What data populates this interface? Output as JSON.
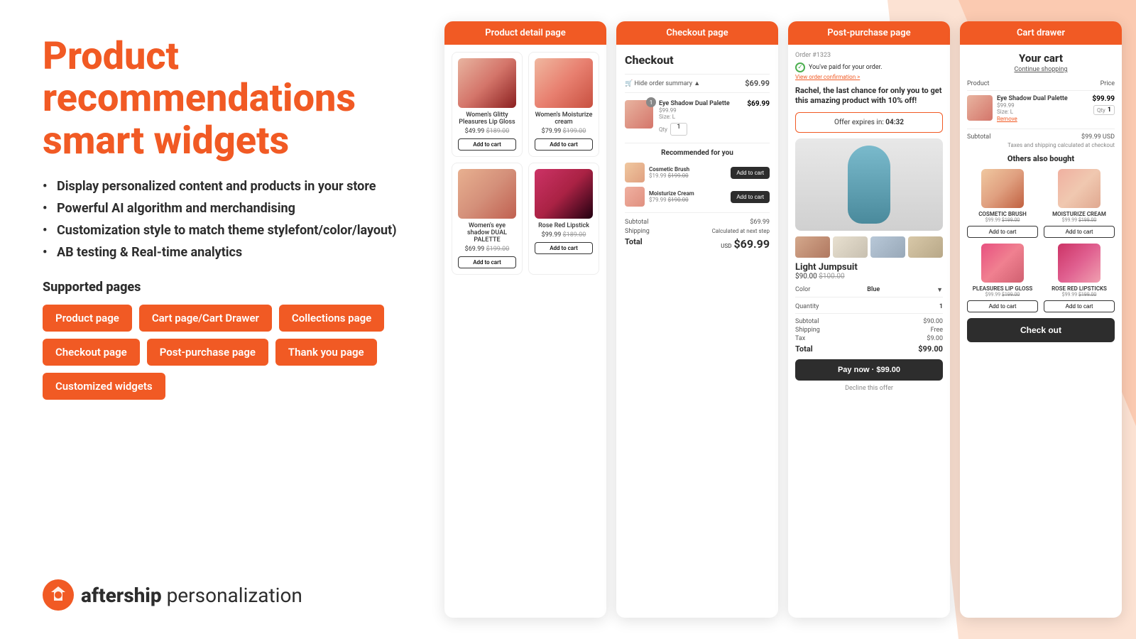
{
  "hero": {
    "title_line1": "Product",
    "title_line2": "recommendations",
    "title_highlight": "smart widgets"
  },
  "features": [
    "Display personalized content and products in your store",
    "Powerful AI algorithm and merchandising",
    "Customization style to match theme stylefont/color/layout)",
    "AB testing & Real-time analytics"
  ],
  "supported_pages": {
    "label": "Supported pages",
    "badges": [
      "Product page",
      "Cart page/Cart Drawer",
      "Collections page",
      "Checkout page",
      "Post-purchase page",
      "Thank you page",
      "Customized widgets"
    ]
  },
  "brand": {
    "name_bold": "aftership",
    "name_rest": " personalization"
  },
  "panels": {
    "product_detail": {
      "header": "Product detail page",
      "products": [
        {
          "name": "Women's Glitty Pleasures Lip Gloss",
          "price": "$49.99",
          "original": "$189.00",
          "add_btn": "Add to cart"
        },
        {
          "name": "Women's Moisturize cream",
          "price": "$79.99",
          "original": "$199.00",
          "add_btn": "Add to cart"
        },
        {
          "name": "Women's eye shadow DUAL PALETTE",
          "price": "$69.99",
          "original": "$199.00",
          "add_btn": "Add to cart"
        },
        {
          "name": "Rose Red Lipstick",
          "price": "$99.99",
          "original": "$189.00",
          "add_btn": "Add to cart"
        }
      ]
    },
    "checkout": {
      "header": "Checkout page",
      "title": "Checkout",
      "summary_toggle": "Hide order summary",
      "summary_price": "$69.99",
      "cart_item": {
        "name": "Eye Shadow Dual Palette",
        "price": "$99.99",
        "size": "Size: L",
        "qty_label": "Qty",
        "qty": "1",
        "total": "$69.99"
      },
      "recommended_title": "Recommended for you",
      "rec_items": [
        {
          "name": "Cosmetic Brush",
          "price": "$19.99",
          "original": "$199.00",
          "add_btn": "Add to cart"
        },
        {
          "name": "Moisturize Cream",
          "price": "$79.99",
          "original": "$190.00",
          "add_btn": "Add to cart"
        }
      ],
      "subtotal_label": "Subtotal",
      "subtotal_val": "$69.99",
      "shipping_label": "Shipping",
      "shipping_val": "Calculated at next step",
      "total_label": "Total",
      "total_usd": "USD",
      "total_val": "$69.99"
    },
    "post_purchase": {
      "header": "Post-purchase page",
      "order_num": "Order #1323",
      "paid_msg": "You've paid for your order.",
      "view_order": "View order confirmation >",
      "upsell_msg": "Rachel, the last chance for only you to get this amazing product with 10% off!",
      "offer_label": "Offer expires in:",
      "offer_time": "04:32",
      "product_name": "Light Jumpsuit",
      "product_price": "$90.00",
      "product_original": "$100.00",
      "color_label": "Color",
      "color_val": "Blue",
      "qty_label": "Quantity",
      "qty_val": "1",
      "subtotal_label": "Subtotal",
      "subtotal_val": "$90.00",
      "shipping_label": "Shipping",
      "shipping_val": "Free",
      "tax_label": "Tax",
      "tax_val": "$9.00",
      "total_label": "Total",
      "total_val": "$99.00",
      "pay_btn": "Pay now · $99.00",
      "decline_btn": "Decline this offer"
    },
    "cart_drawer": {
      "header": "Cart drawer",
      "your_cart": "Your cart",
      "continue_shopping": "Continue shopping",
      "col_product": "Product",
      "col_price": "Price",
      "cart_item": {
        "name": "Eye Shadow Dual Palette",
        "price": "$99.99",
        "size": "Size: L",
        "remove": "Remove",
        "qty_label": "Qty",
        "qty": "1",
        "total": "$99.99"
      },
      "subtotal_label": "Subtotal",
      "subtotal_val": "$99.99 USD",
      "tax_note": "Taxes and shipping calculated at checkout",
      "others_bought_title": "Others also bought",
      "rec_items": [
        {
          "name": "COSMETIC BRUSH",
          "price": "$99.99",
          "original": "$199.00",
          "add_btn": "Add to cart"
        },
        {
          "name": "MOISTURIZE CREAM",
          "price": "$99.99",
          "original": "$199.00",
          "add_btn": "Add to cart"
        },
        {
          "name": "PLEASURES LIP GLOSS",
          "price": "$99.99",
          "original": "$199.00",
          "add_btn": "Add to cart"
        },
        {
          "name": "ROSE RED LIPSTICKS",
          "price": "$99.99",
          "original": "$199.00",
          "add_btn": "Add to cart"
        }
      ],
      "checkout_btn": "Check out"
    }
  }
}
